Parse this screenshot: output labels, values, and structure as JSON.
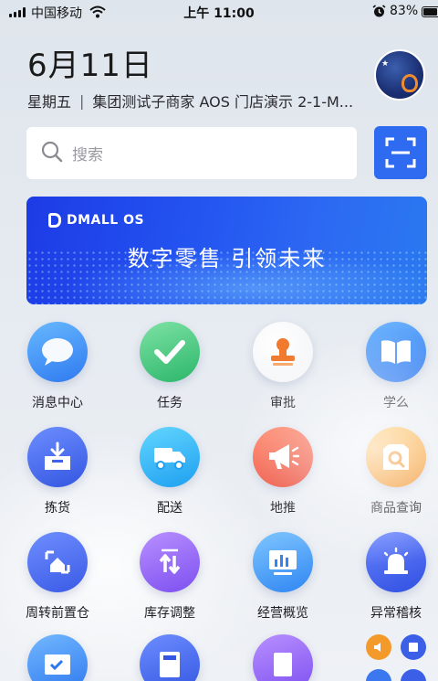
{
  "status_bar": {
    "carrier": "中国移动",
    "time": "上午 11:00",
    "battery_percent": "83%",
    "battery_level": 0.83,
    "icons": [
      "signal-icon",
      "wifi-icon",
      "alarm-icon",
      "battery-icon"
    ]
  },
  "header": {
    "date": "6月11日",
    "weekday": "星期五",
    "separator": "|",
    "store": "集团测试子商家 AOS 门店演示 2-1-M..."
  },
  "search": {
    "placeholder": "搜索"
  },
  "banner": {
    "brand": "DMALL OS",
    "slogan": "数字零售  引领未来"
  },
  "apps": [
    {
      "label": "消息中心",
      "icon": "chat-bubble-icon"
    },
    {
      "label": "任务",
      "icon": "checkmark-icon"
    },
    {
      "label": "审批",
      "icon": "stamp-icon"
    },
    {
      "label": "学么",
      "icon": "book-icon"
    },
    {
      "label": "拣货",
      "icon": "box-download-icon"
    },
    {
      "label": "配送",
      "icon": "delivery-truck-icon"
    },
    {
      "label": "地推",
      "icon": "megaphone-icon"
    },
    {
      "label": "商品查询",
      "icon": "product-search-icon"
    },
    {
      "label": "周转前置仓",
      "icon": "warehouse-icon"
    },
    {
      "label": "库存调整",
      "icon": "adjust-arrows-icon"
    },
    {
      "label": "经营概览",
      "icon": "bar-chart-icon"
    },
    {
      "label": "异常稽核",
      "icon": "alarm-light-icon"
    }
  ],
  "colors": {
    "accent": "#2f6bf0",
    "banner": "#2353f0"
  }
}
